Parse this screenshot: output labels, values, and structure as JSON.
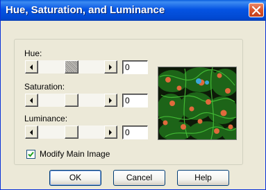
{
  "window": {
    "title": "Hue, Saturation, and Luminance"
  },
  "controls": {
    "hue": {
      "label": "Hue:",
      "value": "0",
      "slider_level": 0.5
    },
    "saturation": {
      "label": "Saturation:",
      "value": "0",
      "slider_level": 0.5
    },
    "luminance": {
      "label": "Luminance:",
      "value": "0",
      "slider_level": 0.5
    }
  },
  "checkbox": {
    "label": "Modify Main Image",
    "checked": true
  },
  "buttons": {
    "ok": "OK",
    "cancel": "Cancel",
    "help": "Help"
  },
  "icons": {
    "close": "close-icon",
    "scroll_left": "arrow-left-icon",
    "scroll_right": "arrow-right-icon",
    "check": "checkmark-icon"
  },
  "colors": {
    "title_bar": "#0554e3",
    "close_button": "#d9542c",
    "dialog_bg": "#ece9d8"
  }
}
